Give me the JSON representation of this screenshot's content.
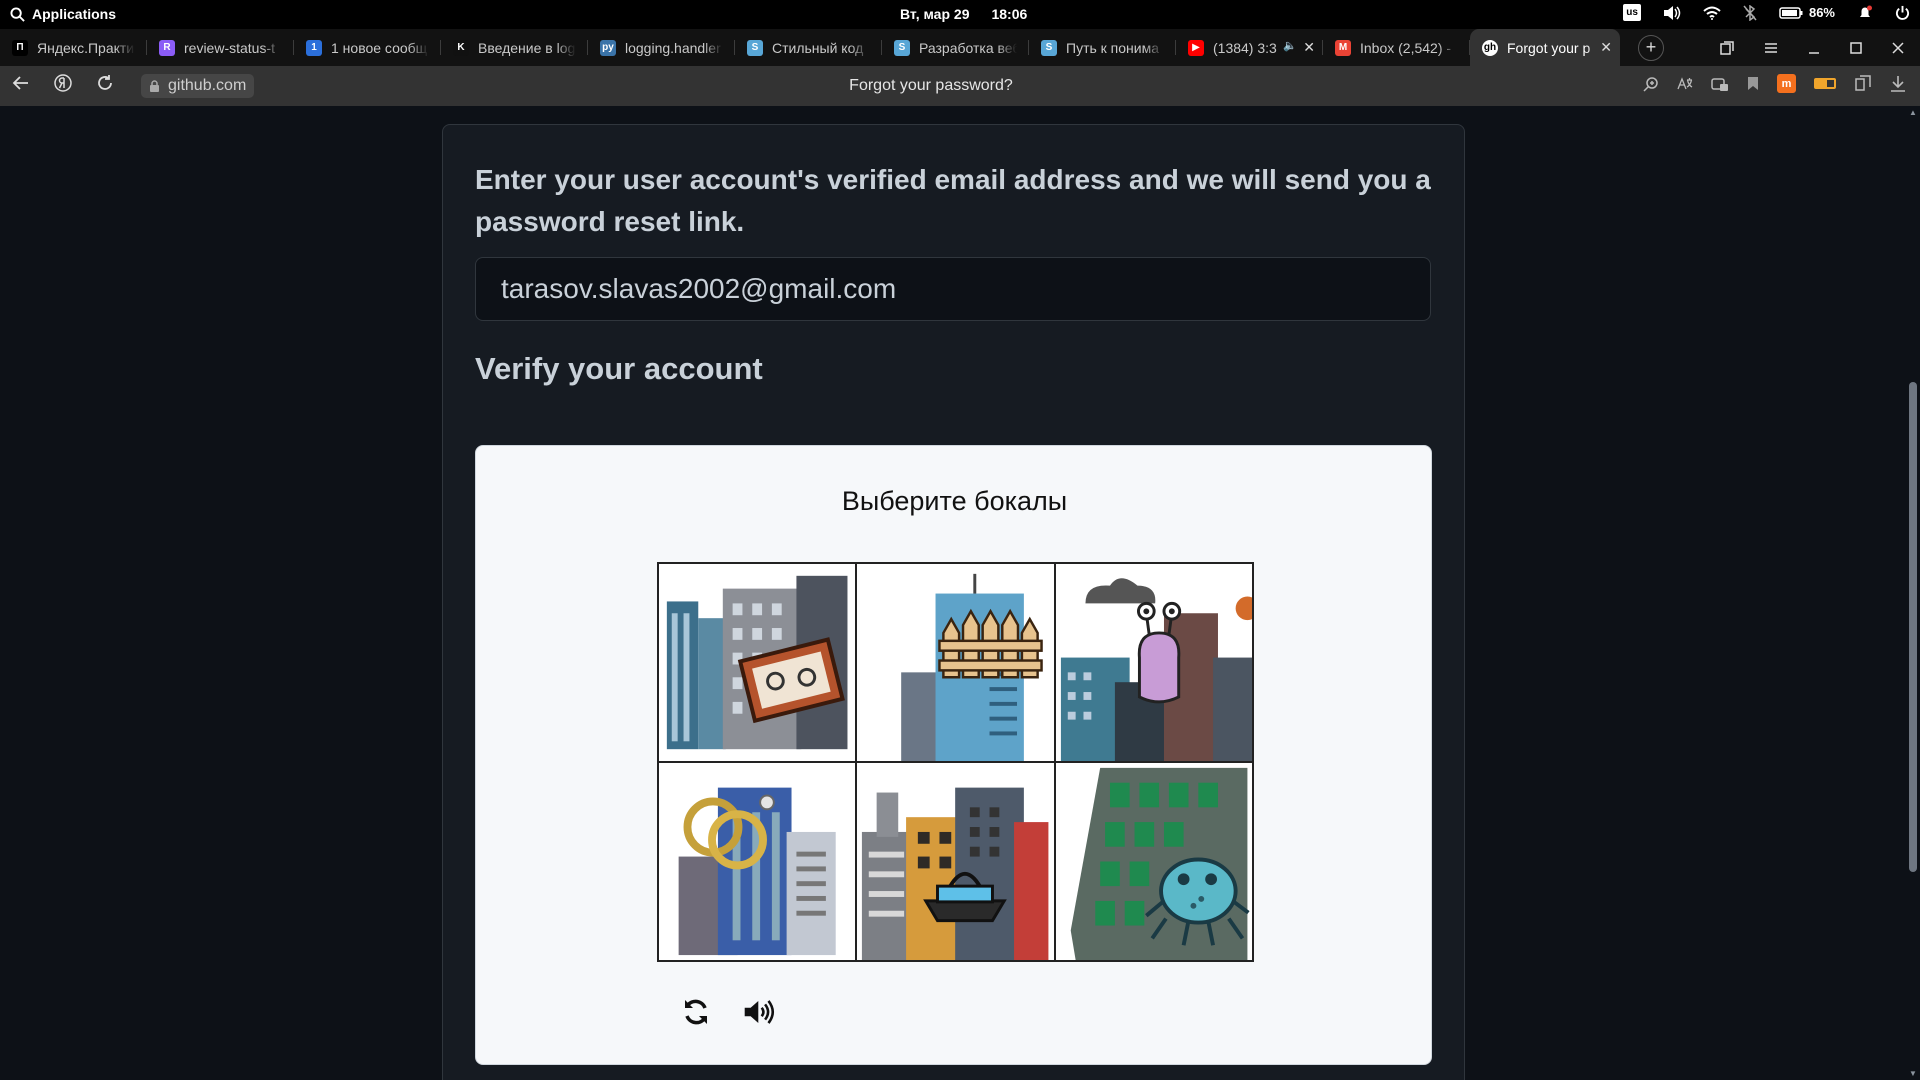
{
  "os": {
    "apps_label": "Applications",
    "date": "Вт, мар 29",
    "time": "18:06",
    "keyboard_layout": "us",
    "battery": "86%"
  },
  "tabs": [
    {
      "title": "Яндекс.Практи",
      "favicon": "П",
      "color": "#000000"
    },
    {
      "title": "review-status-t",
      "favicon": "R",
      "color": "#8b5cf6"
    },
    {
      "title": "1 новое сообщ",
      "favicon": "1",
      "color": "#2b6fdb"
    },
    {
      "title": "Введение в log",
      "favicon": "K",
      "color": "#111111"
    },
    {
      "title": "logging.handler",
      "favicon": "py",
      "color": "#3a73a8"
    },
    {
      "title": "Стильный код",
      "favicon": "S",
      "color": "#58a6d6"
    },
    {
      "title": "Разработка веб",
      "favicon": "S",
      "color": "#58a6d6"
    },
    {
      "title": "Путь к понима",
      "favicon": "S",
      "color": "#58a6d6"
    },
    {
      "title": "(1384) 3:3",
      "favicon": "▶",
      "color": "#ff0000"
    },
    {
      "title": "Inbox (2,542) -",
      "favicon": "M",
      "color": "#ea4335"
    },
    {
      "title": "Forgot your p",
      "favicon": "gh",
      "color": "#ffffff"
    }
  ],
  "address": {
    "domain": "github.com",
    "page_title": "Forgot your password?"
  },
  "form": {
    "instruction": "Enter your user account's verified email address and we will send you a password reset link.",
    "email_value": "tarasov.slavas2002@gmail.com",
    "verify_heading": "Verify your account"
  },
  "captcha": {
    "prompt": "Выберите бокалы",
    "tiles": [
      {
        "object": "photo-frame"
      },
      {
        "object": "wooden-fence"
      },
      {
        "object": "monster-creature"
      },
      {
        "object": "wedding-rings"
      },
      {
        "object": "boat"
      },
      {
        "object": "bug-creature"
      }
    ]
  },
  "icons": {
    "refresh": "refresh-icon",
    "audio": "speaker-icon"
  }
}
